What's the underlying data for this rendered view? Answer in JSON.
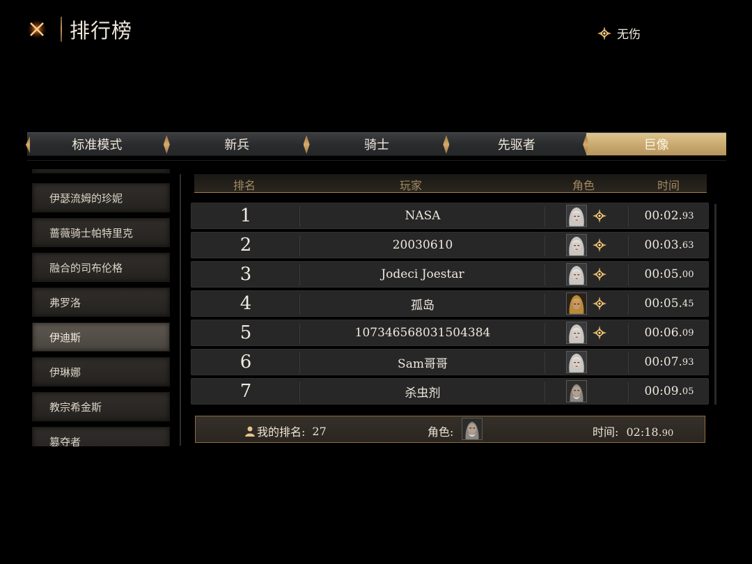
{
  "header": {
    "title": "排行榜",
    "close_icon": "close-x-icon",
    "nohit_label": "无伤"
  },
  "tabs": [
    {
      "label": "标准模式",
      "active": false
    },
    {
      "label": "新兵",
      "active": false
    },
    {
      "label": "骑士",
      "active": false
    },
    {
      "label": "先驱者",
      "active": false
    },
    {
      "label": "巨像",
      "active": true
    }
  ],
  "boss_list": [
    {
      "label": "伊瑟流姆的珍妮",
      "active": false
    },
    {
      "label": "蔷薇骑士帕特里克",
      "active": false
    },
    {
      "label": "融合的司布伦格",
      "active": false
    },
    {
      "label": "弗罗洛",
      "active": false
    },
    {
      "label": "伊迪斯",
      "active": true
    },
    {
      "label": "伊琳娜",
      "active": false
    },
    {
      "label": "教宗希金斯",
      "active": false
    },
    {
      "label": "篡夺者",
      "active": false
    }
  ],
  "table": {
    "headers": {
      "rank": "排名",
      "player": "玩家",
      "role": "角色",
      "time": "时间"
    },
    "rows": [
      {
        "rank": "1",
        "player": "NASA",
        "portrait": "silver-hair",
        "nohit": true,
        "time_main": "00:02.",
        "time_ms": "93"
      },
      {
        "rank": "2",
        "player": "20030610",
        "portrait": "silver-hair",
        "nohit": true,
        "time_main": "00:03.",
        "time_ms": "63"
      },
      {
        "rank": "3",
        "player": "Jodeci Joestar",
        "portrait": "silver-hair",
        "nohit": true,
        "time_main": "00:05.",
        "time_ms": "00"
      },
      {
        "rank": "4",
        "player": "孤岛",
        "portrait": "gold-hair",
        "nohit": true,
        "time_main": "00:05.",
        "time_ms": "45"
      },
      {
        "rank": "5",
        "player": "107346568031504384",
        "portrait": "silver-hair",
        "nohit": true,
        "time_main": "00:06.",
        "time_ms": "09"
      },
      {
        "rank": "6",
        "player": "Sam哥哥",
        "portrait": "silver-hair",
        "nohit": false,
        "time_main": "00:07.",
        "time_ms": "93"
      },
      {
        "rank": "7",
        "player": "杀虫剂",
        "portrait": "old-man",
        "nohit": false,
        "time_main": "00:09.",
        "time_ms": "05"
      }
    ]
  },
  "footer": {
    "my_rank_label": "我的排名:",
    "my_rank_value": "27",
    "role_label": "角色:",
    "role_portrait": "old-man",
    "time_label": "时间:",
    "time_main": "02:18.",
    "time_ms": "90"
  },
  "colors": {
    "accent_gold": "#c8a970",
    "panel": "#272727",
    "text": "#efe9df"
  }
}
